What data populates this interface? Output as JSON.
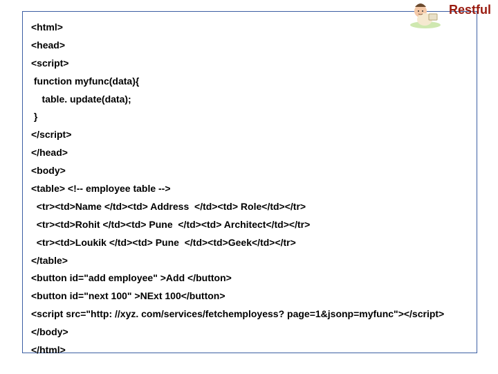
{
  "title": "Restful",
  "code_lines": [
    "<html>",
    "<head>",
    "<script>",
    " function myfunc(data){",
    "    table. update(data);",
    " }",
    "</script>",
    "</head>",
    "<body>",
    "<table> <!-- employee table -->",
    "  <tr><td>Name </td><td> Address  </td><td> Role</td></tr>",
    "  <tr><td>Rohit </td><td> Pune  </td><td> Architect</td></tr>",
    "  <tr><td>Loukik </td><td> Pune  </td><td>Geek</td></tr>",
    "</table>",
    "<button id=\"add employee\" >Add </button>",
    "<button id=\"next 100\" >NExt 100</button>",
    "<script src=\"http: //xyz. com/services/fetchemployess? page=1&jsonp=myfunc\"></script>",
    "</body>",
    "</html>"
  ]
}
